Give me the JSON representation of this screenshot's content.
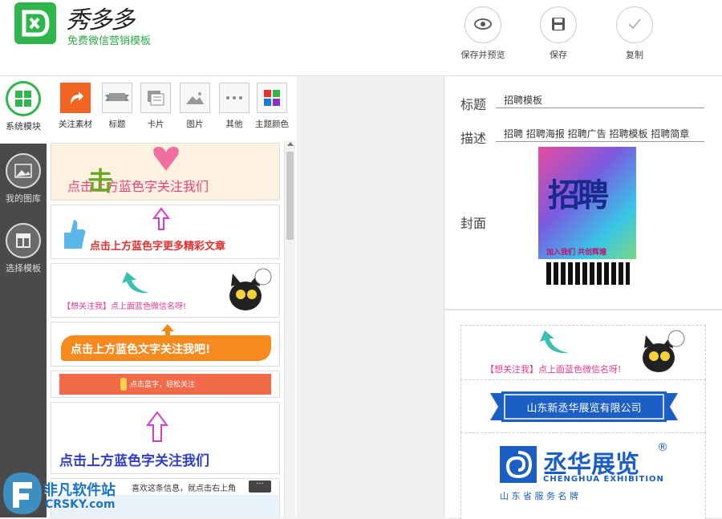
{
  "header": {
    "brand": "秀多多",
    "slogan": "免费微信营销模板",
    "actions": [
      {
        "label": "保存并预览",
        "icon": "eye-icon"
      },
      {
        "label": "保存",
        "icon": "floppy-icon"
      },
      {
        "label": "复制",
        "icon": "check-icon"
      }
    ]
  },
  "nav": [
    {
      "label": "系统模块",
      "icon": "grid-icon"
    },
    {
      "label": "我的图库",
      "icon": "image-icon"
    },
    {
      "label": "选择模板",
      "icon": "template-icon"
    }
  ],
  "categories": [
    {
      "label": "关注素材"
    },
    {
      "label": "标题"
    },
    {
      "label": "卡片"
    },
    {
      "label": "图片"
    },
    {
      "label": "其他"
    },
    {
      "label": "主题颜色"
    }
  ],
  "templates": {
    "t1": "点击上方蓝色字关注我们",
    "t1_big": "击",
    "t2": "点击上方蓝色字更多精彩文章",
    "t3": "【想关注我】点上面蓝色微信名呀!",
    "t4": "点击上方蓝色文字关注我吧!",
    "t5": "点击蓝字，轻松关注",
    "t6": "点击上方蓝色字关注我们",
    "t7": "喜欢这条信息，就点击右上角"
  },
  "form": {
    "title_label": "标题",
    "title_value": "招聘模板",
    "desc_label": "描述",
    "desc_value": "招聘 招聘海报 招聘广告 招聘模板 招聘简章",
    "cover_label": "封面",
    "cover_big": "招聘",
    "cover_small": "加入我们 共创辉煌"
  },
  "preview": {
    "follow_text": "【想关注我】点上面蓝色微信名呀!",
    "company_banner": "山东新丞华展览有限公司",
    "brand_cn": "丞华展览",
    "brand_en": "CHENGHUA EXHIBITION",
    "brand_tag": "山 东 省 服 务 名 牌"
  },
  "watermark": {
    "cn": "非凡软件站",
    "en": "CRSKY.com"
  }
}
